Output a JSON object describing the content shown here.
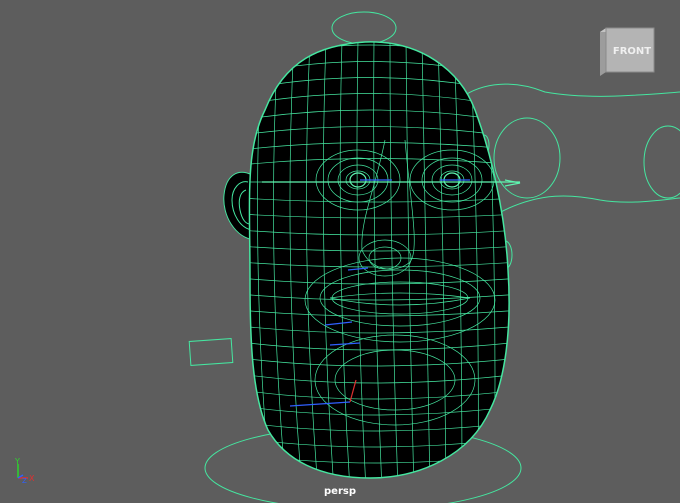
{
  "viewport": {
    "camera_name": "persp",
    "background": "#5d5d5d",
    "wire_color": "#45e6a0",
    "mesh_fill": "#000000"
  },
  "viewcube": {
    "face_label": "FRONT",
    "icon": "view-cube-icon"
  },
  "axis_gizmo": {
    "y_label": "Y",
    "x_label": "X",
    "z_label": "Z",
    "y_color": "#2dd52d",
    "x_color": "#e03030",
    "z_color": "#3060ff"
  }
}
